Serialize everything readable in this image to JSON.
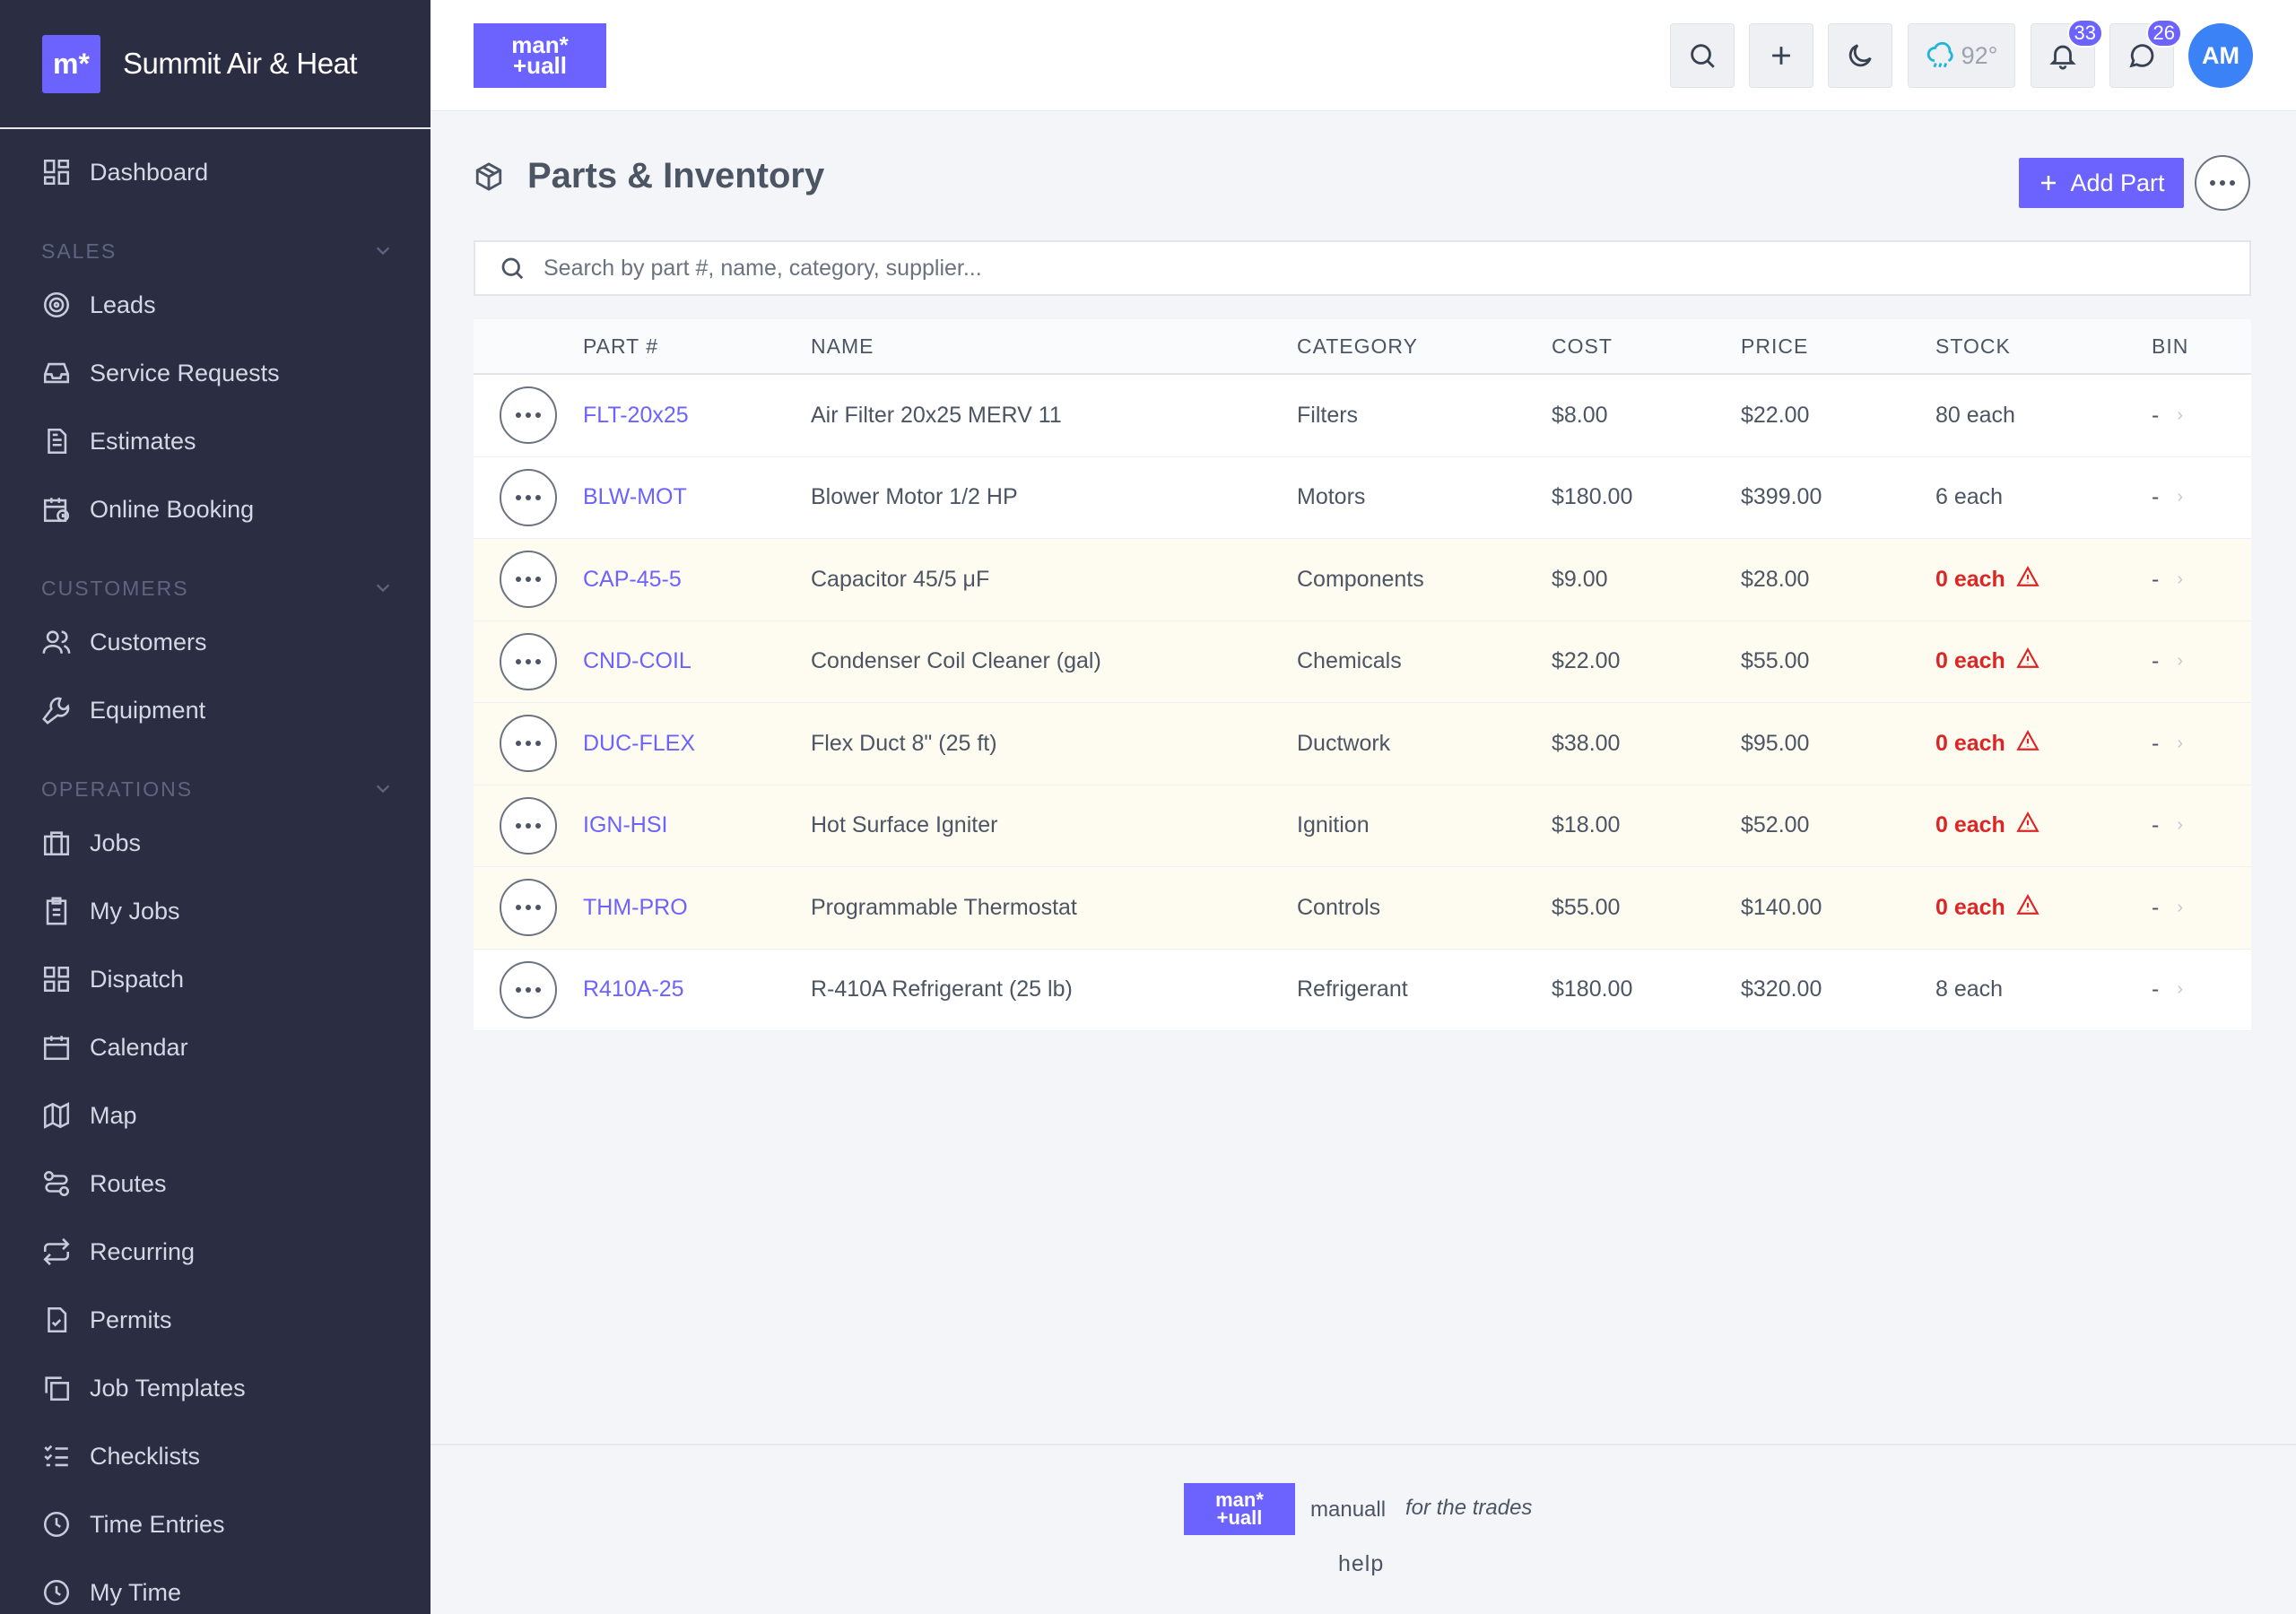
{
  "brand": {
    "logo": "m*",
    "name": "Summit Air & Heat"
  },
  "topbar": {
    "logo_top": "man*",
    "logo_bottom": "+uall",
    "weather": "92°",
    "notifications_count": "33",
    "messages_count": "26",
    "avatar_initials": "AM"
  },
  "sidebar": {
    "dashboard": "Dashboard",
    "sales_section": "SALES",
    "sales": [
      {
        "label": "Leads",
        "icon": "target-icon"
      },
      {
        "label": "Service Requests",
        "icon": "inbox-icon"
      },
      {
        "label": "Estimates",
        "icon": "document-icon"
      },
      {
        "label": "Online Booking",
        "icon": "calendar-clock-icon"
      }
    ],
    "customers_section": "CUSTOMERS",
    "customers": [
      {
        "label": "Customers",
        "icon": "users-icon"
      },
      {
        "label": "Equipment",
        "icon": "wrench-icon"
      }
    ],
    "operations_section": "OPERATIONS",
    "operations": [
      {
        "label": "Jobs",
        "icon": "briefcase-icon"
      },
      {
        "label": "My Jobs",
        "icon": "clipboard-icon"
      },
      {
        "label": "Dispatch",
        "icon": "grid-icon"
      },
      {
        "label": "Calendar",
        "icon": "calendar-icon"
      },
      {
        "label": "Map",
        "icon": "map-icon"
      },
      {
        "label": "Routes",
        "icon": "route-icon"
      },
      {
        "label": "Recurring",
        "icon": "repeat-icon"
      },
      {
        "label": "Permits",
        "icon": "file-check-icon"
      },
      {
        "label": "Job Templates",
        "icon": "copy-icon"
      },
      {
        "label": "Checklists",
        "icon": "checklist-icon"
      },
      {
        "label": "Time Entries",
        "icon": "clock-icon"
      },
      {
        "label": "My Time",
        "icon": "clock-icon"
      }
    ]
  },
  "page": {
    "title": "Parts & Inventory",
    "add_button": "Add Part",
    "search_placeholder": "Search by part #, name, category, supplier..."
  },
  "table": {
    "headers": [
      "PART #",
      "NAME",
      "CATEGORY",
      "COST",
      "PRICE",
      "STOCK",
      "BIN"
    ],
    "rows": [
      {
        "part": "FLT-20x25",
        "name": "Air Filter 20x25 MERV 11",
        "category": "Filters",
        "cost": "$8.00",
        "price": "$22.00",
        "stock": "80 each",
        "bin": "-",
        "out": false
      },
      {
        "part": "BLW-MOT",
        "name": "Blower Motor 1/2 HP",
        "category": "Motors",
        "cost": "$180.00",
        "price": "$399.00",
        "stock": "6 each",
        "bin": "-",
        "out": false
      },
      {
        "part": "CAP-45-5",
        "name": "Capacitor 45/5 μF",
        "category": "Components",
        "cost": "$9.00",
        "price": "$28.00",
        "stock": "0 each",
        "bin": "-",
        "out": true
      },
      {
        "part": "CND-COIL",
        "name": "Condenser Coil Cleaner (gal)",
        "category": "Chemicals",
        "cost": "$22.00",
        "price": "$55.00",
        "stock": "0 each",
        "bin": "-",
        "out": true
      },
      {
        "part": "DUC-FLEX",
        "name": "Flex Duct 8\" (25 ft)",
        "category": "Ductwork",
        "cost": "$38.00",
        "price": "$95.00",
        "stock": "0 each",
        "bin": "-",
        "out": true
      },
      {
        "part": "IGN-HSI",
        "name": "Hot Surface Igniter",
        "category": "Ignition",
        "cost": "$18.00",
        "price": "$52.00",
        "stock": "0 each",
        "bin": "-",
        "out": true
      },
      {
        "part": "THM-PRO",
        "name": "Programmable Thermostat",
        "category": "Controls",
        "cost": "$55.00",
        "price": "$140.00",
        "stock": "0 each",
        "bin": "-",
        "out": true
      },
      {
        "part": "R410A-25",
        "name": "R-410A Refrigerant (25 lb)",
        "category": "Refrigerant",
        "cost": "$180.00",
        "price": "$320.00",
        "stock": "8 each",
        "bin": "-",
        "out": false
      }
    ]
  },
  "footer": {
    "logo_top": "man*",
    "logo_bottom": "+uall",
    "brand": "manuall",
    "tagline": "for the trades",
    "help": "help"
  },
  "colors": {
    "accent": "#6c63ff",
    "sidebar": "#2b2d42",
    "danger": "#dc2626",
    "low_stock_row": "#fefbf0"
  }
}
